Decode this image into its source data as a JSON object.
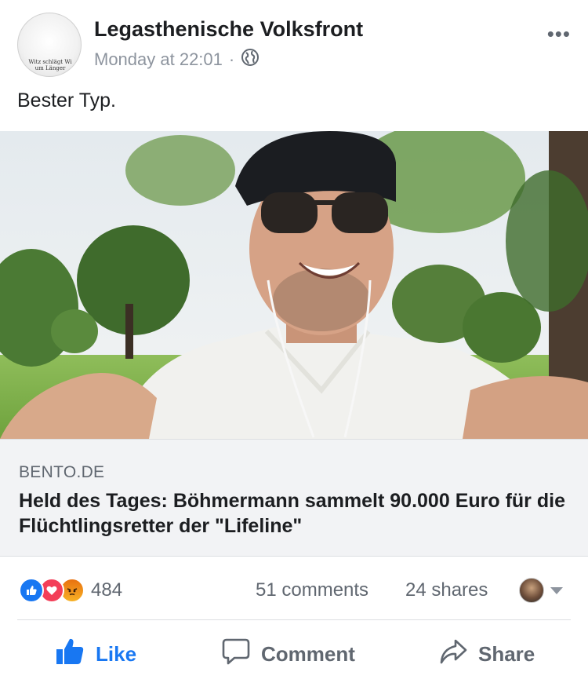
{
  "post": {
    "page_name": "Legasthenische Volksfront",
    "timestamp": "Monday at 22:01",
    "separator": "·",
    "privacy_icon": "globe-icon",
    "more_label": "•••",
    "avatar_logo_line1": "Witz schlägt Wi",
    "avatar_logo_line2": "um Länger",
    "text": "Bester Typ."
  },
  "link_preview": {
    "domain": "BENTO.DE",
    "title": "Held des Tages: Böhmermann sammelt 90.000 Euro für die Flüchtlingsretter der \"Lifeline\""
  },
  "stats": {
    "reaction_icons": [
      "like-reaction-icon",
      "love-reaction-icon",
      "angry-reaction-icon"
    ],
    "reaction_count": "484",
    "comments": "51 comments",
    "shares": "24 shares"
  },
  "actions": {
    "like": "Like",
    "comment": "Comment",
    "share": "Share"
  },
  "colors": {
    "accent": "#1877f2",
    "love": "#f33e58",
    "angry": "#f7b125",
    "secondary_text": "#606770"
  }
}
